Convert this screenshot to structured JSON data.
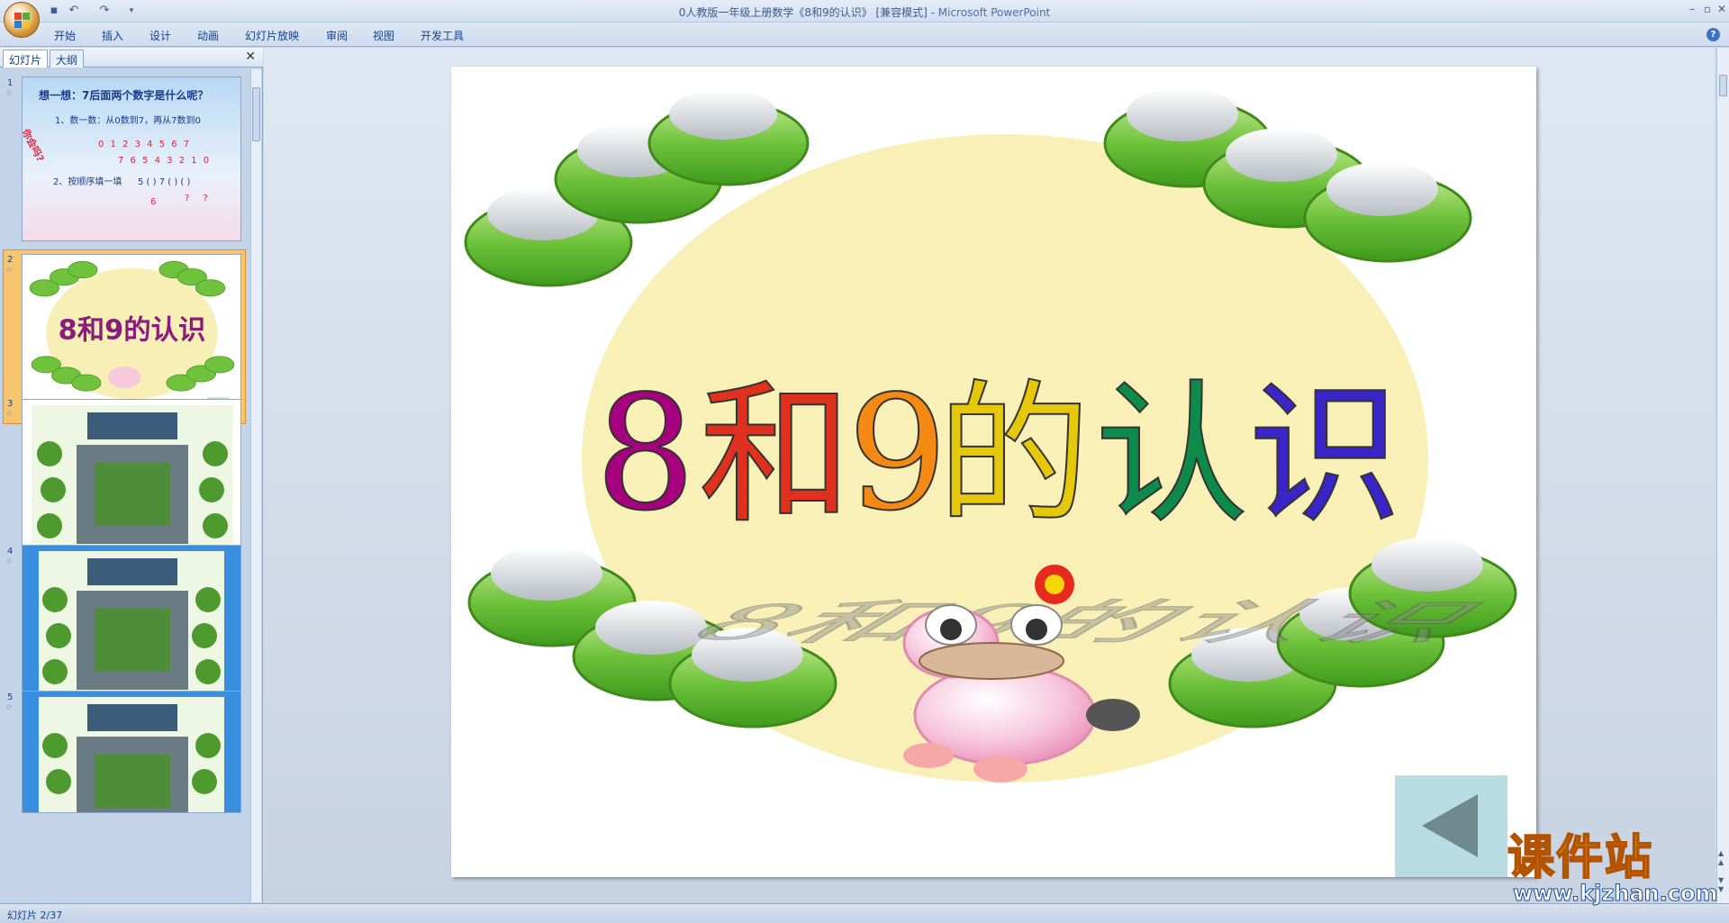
{
  "window": {
    "title": "0人教版一年级上册数学《8和9的认识》 [兼容模式] - ",
    "app_name": "Microsoft PowerPoint"
  },
  "ribbon": {
    "tabs": [
      "开始",
      "插入",
      "设计",
      "动画",
      "幻灯片放映",
      "审阅",
      "视图",
      "开发工具"
    ]
  },
  "pane": {
    "tab_slides": "幻灯片",
    "tab_outline": "大纲"
  },
  "thumbnails": [
    {
      "num": "1",
      "lines": [
        "想一想：7后面两个数字是什么呢？",
        "1、数一数：从0数到7，再从7数到0",
        "0 1 2 3 4 5 6 7",
        "7 6 5 4 3 2 1 0",
        "2、按顺序填一填",
        "5 ( ) 7 ( ) ( )",
        "6",
        "? ?"
      ],
      "side_text": "你会吗?"
    },
    {
      "num": "2",
      "title": "8和9的认识"
    },
    {
      "num": "3"
    },
    {
      "num": "4"
    },
    {
      "num": "5"
    }
  ],
  "slide": {
    "title_chars": [
      "8",
      "和",
      "9",
      "的",
      "认",
      "识"
    ]
  },
  "status": {
    "text": "幻灯片 2/37"
  },
  "watermark": {
    "main": "课件站",
    "url": "www.kjzhan.com"
  },
  "colors": {
    "title_gradient": [
      "#b0007a",
      "#e0311e",
      "#f48a14",
      "#f5d40a",
      "#6fb91e",
      "#0e8a4b",
      "#2530c8",
      "#6a1fb8"
    ]
  }
}
